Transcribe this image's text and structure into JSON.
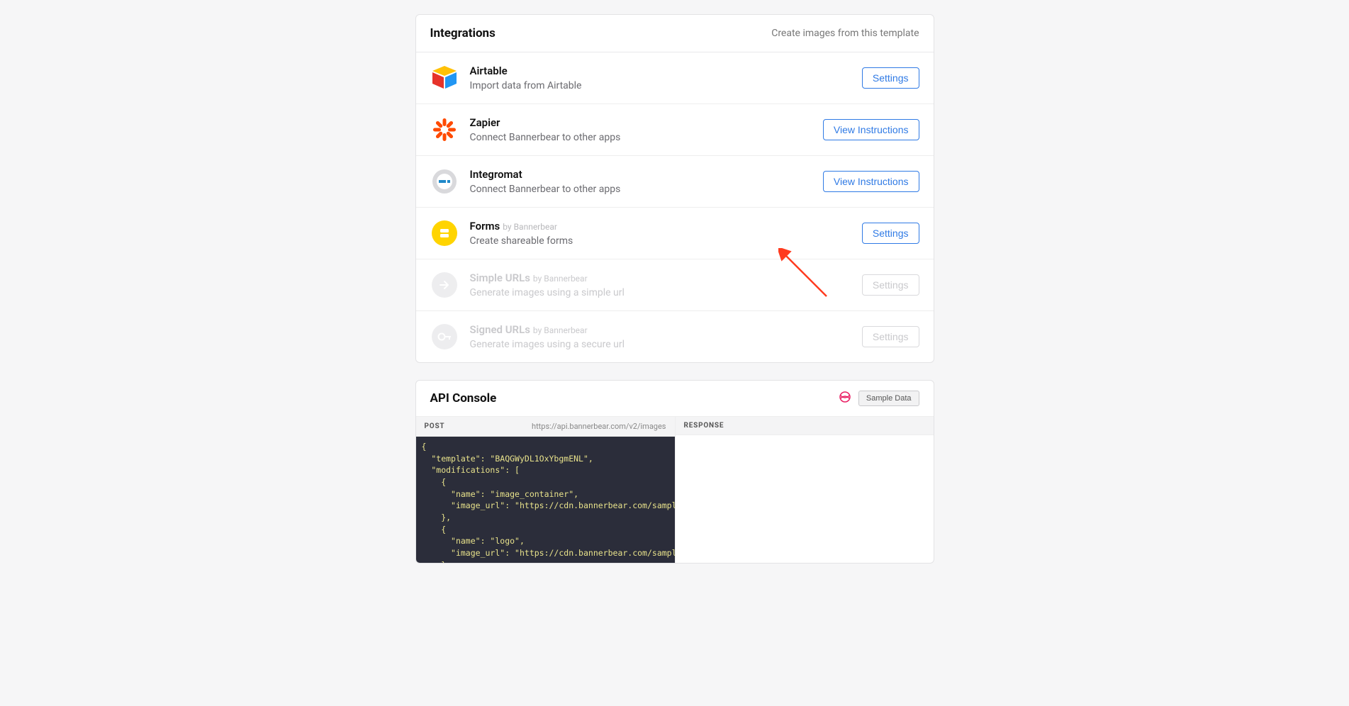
{
  "integrations": {
    "title": "Integrations",
    "subtitle": "Create images from this template",
    "items": [
      {
        "name": "Airtable",
        "desc": "Import data from Airtable",
        "by": "",
        "action": "Settings",
        "disabled": false
      },
      {
        "name": "Zapier",
        "desc": "Connect Bannerbear to other apps",
        "by": "",
        "action": "View Instructions",
        "disabled": false
      },
      {
        "name": "Integromat",
        "desc": "Connect Bannerbear to other apps",
        "by": "",
        "action": "View Instructions",
        "disabled": false
      },
      {
        "name": "Forms",
        "desc": "Create shareable forms",
        "by": "by Bannerbear",
        "action": "Settings",
        "disabled": false
      },
      {
        "name": "Simple URLs",
        "desc": "Generate images using a simple url",
        "by": "by Bannerbear",
        "action": "Settings",
        "disabled": true
      },
      {
        "name": "Signed URLs",
        "desc": "Generate images using a secure url",
        "by": "by Bannerbear",
        "action": "Settings",
        "disabled": true
      }
    ]
  },
  "console": {
    "title": "API Console",
    "sample_button": "Sample Data",
    "post_label": "POST",
    "response_label": "RESPONSE",
    "endpoint": "https://api.bannerbear.com/v2/images",
    "code": "{\n  \"template\": \"BAQGWyDL1OxYbgmENL\",\n  \"modifications\": [\n    {\n      \"name\": \"image_container\",\n      \"image_url\": \"https://cdn.bannerbear.com/sample_images/w\n    },\n    {\n      \"name\": \"logo\",\n      \"image_url\": \"https://cdn.bannerbear.com/sample_images/w\n    },\n    {\n      \"name\": \"title\",\n      \"text\": \"You can change this text\","
  }
}
